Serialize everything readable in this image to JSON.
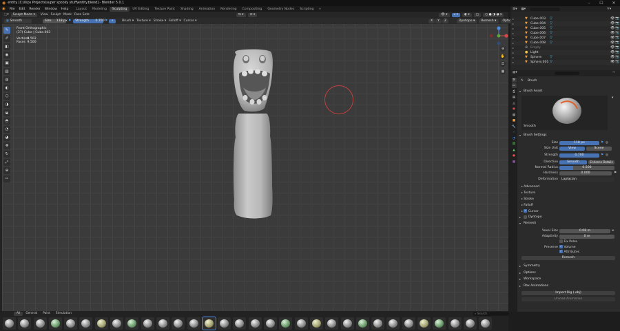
{
  "titlebar": {
    "title": "entity [C:\\Kips Projects\\super spooky stuff\\entity.blend] - Blender 5.0.1"
  },
  "menus": [
    "File",
    "Edit",
    "Render",
    "Window",
    "Help"
  ],
  "workspaces": [
    "Layout",
    "Modeling",
    "Sculpting",
    "UV Editing",
    "Texture Paint",
    "Shading",
    "Animation",
    "Rendering",
    "Compositing",
    "Geometry Nodes",
    "Scripting"
  ],
  "active_workspace": "Sculpting",
  "scene": {
    "name": "Scene",
    "view_layer": "ViewLayer"
  },
  "viewport_header": {
    "mode": "Sculpt Mode",
    "menus": [
      "View",
      "Sculpt",
      "Mask",
      "Face Sets"
    ]
  },
  "tool_header": {
    "brush": "Smooth",
    "size_label": "Size",
    "size_value": "118 px",
    "strength_label": "Strength",
    "strength_value": "0.700",
    "dropdowns": [
      "Brush",
      "Texture",
      "Stroke",
      "Falloff",
      "Cursor"
    ],
    "axes": [
      "X",
      "Y",
      "Z"
    ],
    "right_dropdowns": [
      "Dyntopo",
      "Remesh",
      "Options"
    ]
  },
  "viewport_info": {
    "view": "Front Orthographic",
    "object": "(37) Cube | Cube.003",
    "vertices_label": "Vertices",
    "vertices_value": "9,502",
    "faces_label": "Faces",
    "faces_value": "9,500"
  },
  "outliner": {
    "items": [
      {
        "name": "Cube.003",
        "icon": "mesh-icon",
        "dim": false
      },
      {
        "name": "Cube.004",
        "icon": "mesh-icon",
        "dim": false
      },
      {
        "name": "Cube.005",
        "icon": "mesh-icon",
        "dim": false
      },
      {
        "name": "Cube.006",
        "icon": "mesh-icon",
        "dim": false
      },
      {
        "name": "Cube.007",
        "icon": "mesh-icon",
        "dim": false
      },
      {
        "name": "Cube.008",
        "icon": "mesh-icon",
        "dim": false
      },
      {
        "name": "Empty",
        "icon": "empty-icon",
        "dim": true
      },
      {
        "name": "Light",
        "icon": "light-icon",
        "dim": false
      },
      {
        "name": "Sphere",
        "icon": "mesh-icon",
        "dim": false
      },
      {
        "name": "Sphere.001",
        "icon": "mesh-icon",
        "dim": false
      }
    ]
  },
  "properties": {
    "tool_title": "Brush",
    "brush_asset_section": "Brush Asset",
    "brush_asset_name": "Smooth",
    "brush_settings_section": "Brush Settings",
    "size_label": "Size",
    "size_value": "118 px",
    "size_unit_label": "Size Unit",
    "size_unit_view": "View",
    "size_unit_scene": "Scene",
    "strength_label": "Strength",
    "strength_value": "0.700",
    "direction_label": "Direction",
    "direction_smooth": "Smooth",
    "direction_enhance": "Enhance Details",
    "normal_radius_label": "Normal Radius",
    "normal_radius_value": "0.500",
    "hardness_label": "Hardness",
    "hardness_value": "0.000",
    "deformation_label": "Deformation",
    "deformation_value": "Laplacian",
    "subsections": [
      "Advanced",
      "Texture",
      "Stroke",
      "Falloff",
      "Cursor"
    ],
    "dyntopo": "Dyntopo",
    "remesh_section": "Remesh",
    "voxel_size_label": "Voxel Size",
    "voxel_size_value": "0.08 m",
    "adaptivity_label": "Adaptivity",
    "adaptivity_value": "0 m",
    "fix_poles": "Fix Poles",
    "preserve_label": "Preserve",
    "preserve_volume": "Volume",
    "preserve_attributes": "Attributes",
    "remesh_button": "Remesh",
    "collapsed_sections": [
      "Symmetry",
      "Options",
      "Workspace",
      "Rbx Animations"
    ],
    "import_rig_button": "Import Rig (.obj)",
    "unload_button": "Unload Animation"
  },
  "asset_shelf": {
    "tabs": [
      "All",
      "General",
      "Paint",
      "Simulation"
    ],
    "active_tab": "All",
    "search_placeholder": "Search",
    "brush_count": 32,
    "selected_index": 13
  },
  "colors": {
    "accent": "#4772b3",
    "brush_cursor": "#c04040",
    "object_icon": "#f0a040",
    "modifier_icon": "#5bd3ff"
  }
}
